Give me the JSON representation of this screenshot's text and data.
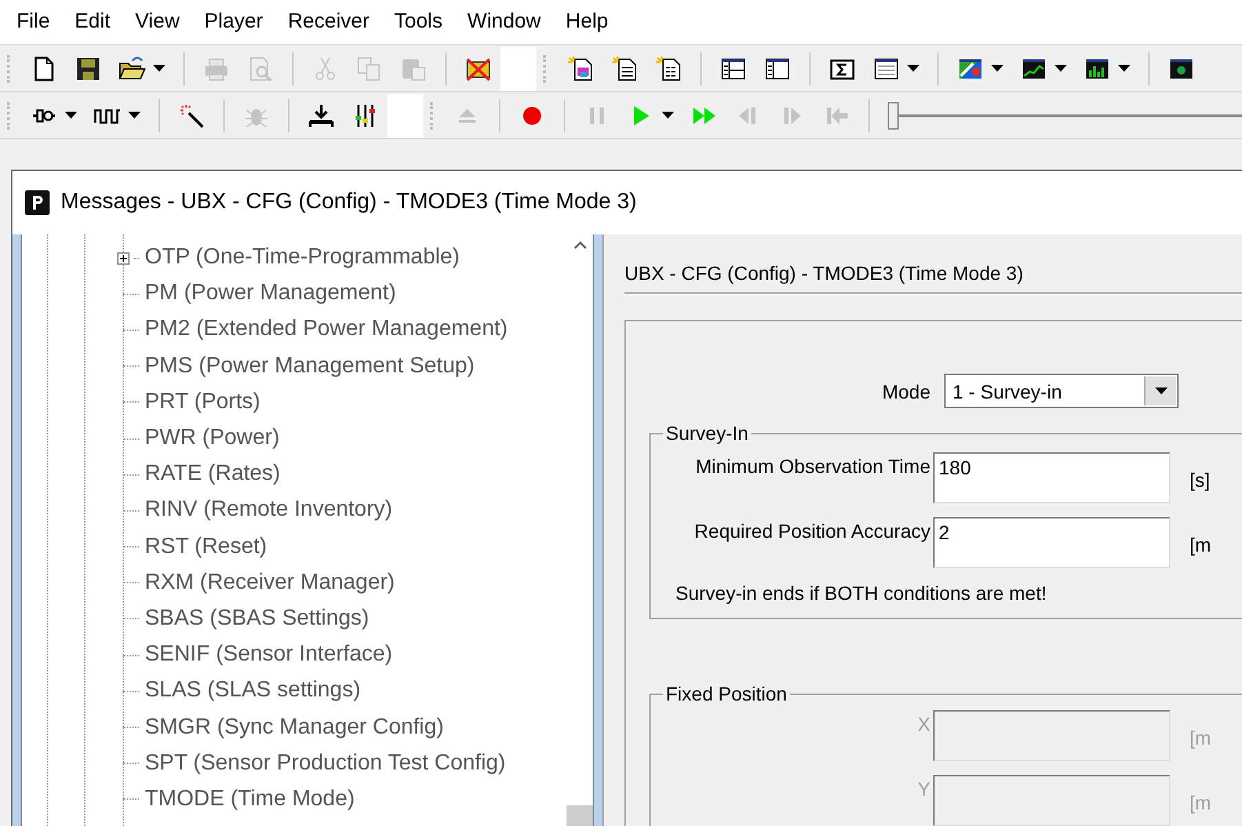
{
  "menu": [
    "File",
    "Edit",
    "View",
    "Player",
    "Receiver",
    "Tools",
    "Window",
    "Help"
  ],
  "toolbars": [
    {
      "bands": [
        {
          "groups": [
            [
              {
                "kind": "new-file",
                "disabled": false
              },
              {
                "kind": "save",
                "disabled": false
              },
              {
                "kind": "open-folder",
                "disabled": false,
                "dropdown": true
              }
            ],
            [
              {
                "kind": "print",
                "disabled": true
              },
              {
                "kind": "print-preview",
                "disabled": true
              }
            ],
            [
              {
                "kind": "cut",
                "disabled": true
              },
              {
                "kind": "copy",
                "disabled": true
              },
              {
                "kind": "paste",
                "disabled": true
              }
            ],
            [
              {
                "kind": "disconnect",
                "disabled": false
              }
            ]
          ]
        },
        {
          "groups": [
            [
              {
                "kind": "new-binary",
                "disabled": false
              },
              {
                "kind": "new-text",
                "disabled": false
              },
              {
                "kind": "new-data",
                "disabled": false
              }
            ],
            [
              {
                "kind": "layout-split",
                "disabled": false
              },
              {
                "kind": "layout-side",
                "disabled": false
              }
            ],
            [
              {
                "kind": "sigma",
                "disabled": false
              },
              {
                "kind": "table",
                "disabled": false,
                "dropdown": true
              }
            ],
            [
              {
                "kind": "color-chart",
                "disabled": false,
                "dropdown": true
              },
              {
                "kind": "line-chart",
                "disabled": false,
                "dropdown": true
              },
              {
                "kind": "bar-chart",
                "disabled": false,
                "dropdown": true
              }
            ],
            [
              {
                "kind": "screen",
                "disabled": false
              }
            ]
          ]
        }
      ]
    },
    {
      "bands": [
        {
          "groups": [
            [
              {
                "kind": "connector",
                "disabled": false,
                "dropdown": true
              },
              {
                "kind": "pulse",
                "disabled": false,
                "dropdown": true
              }
            ],
            [
              {
                "kind": "wand",
                "disabled": false
              }
            ],
            [
              {
                "kind": "bug",
                "disabled": true
              }
            ],
            [
              {
                "kind": "download",
                "disabled": false
              },
              {
                "kind": "mixer",
                "disabled": false
              }
            ]
          ]
        },
        {
          "groups": [
            [
              {
                "kind": "eject",
                "disabled": true
              }
            ],
            [
              {
                "kind": "record",
                "disabled": false
              }
            ],
            [
              {
                "kind": "pause",
                "disabled": true
              },
              {
                "kind": "play",
                "disabled": false,
                "dropdown": true
              },
              {
                "kind": "fast-forward",
                "disabled": false
              },
              {
                "kind": "step-back",
                "disabled": true
              },
              {
                "kind": "step-forward",
                "disabled": true
              },
              {
                "kind": "to-start",
                "disabled": true
              }
            ]
          ],
          "slider": {
            "level": 0
          }
        }
      ]
    }
  ],
  "window": {
    "title": "Messages - UBX - CFG (Config) - TMODE3 (Time Mode 3)"
  },
  "tree": {
    "items": [
      {
        "label": "OTP (One-Time-Programmable)",
        "kind": "folder",
        "expanded": false
      },
      {
        "label": "PM (Power Management)",
        "kind": "leaf"
      },
      {
        "label": "PM2 (Extended Power Management)",
        "kind": "leaf"
      },
      {
        "label": "PMS (Power Management Setup)",
        "kind": "leaf"
      },
      {
        "label": "PRT (Ports)",
        "kind": "leaf"
      },
      {
        "label": "PWR (Power)",
        "kind": "leaf"
      },
      {
        "label": "RATE (Rates)",
        "kind": "leaf"
      },
      {
        "label": "RINV (Remote Inventory)",
        "kind": "leaf"
      },
      {
        "label": "RST (Reset)",
        "kind": "leaf"
      },
      {
        "label": "RXM (Receiver Manager)",
        "kind": "leaf"
      },
      {
        "label": "SBAS (SBAS Settings)",
        "kind": "leaf"
      },
      {
        "label": "SENIF (Sensor Interface)",
        "kind": "leaf"
      },
      {
        "label": "SLAS (SLAS settings)",
        "kind": "leaf"
      },
      {
        "label": "SMGR (Sync Manager Config)",
        "kind": "leaf"
      },
      {
        "label": "SPT (Sensor Production Test Config)",
        "kind": "leaf"
      },
      {
        "label": "TMODE (Time Mode)",
        "kind": "leaf"
      }
    ]
  },
  "panel": {
    "heading": "UBX - CFG (Config) - TMODE3 (Time Mode 3)",
    "mode": {
      "label": "Mode",
      "value": "1 - Survey-in"
    },
    "survey_in": {
      "title": "Survey-In",
      "fields": [
        {
          "label": "Minimum Observation Time",
          "value": "180",
          "unit": "[s]",
          "disabled": false
        },
        {
          "label": "Required Position Accuracy",
          "value": "2",
          "unit": "[m",
          "disabled": false
        }
      ],
      "note": "Survey-in ends if BOTH conditions are met!"
    },
    "fixed_position": {
      "title": "Fixed Position",
      "fields": [
        {
          "label": "X",
          "unit": "[m",
          "disabled": true
        },
        {
          "label": "Y",
          "unit": "[m",
          "disabled": true
        }
      ]
    }
  }
}
